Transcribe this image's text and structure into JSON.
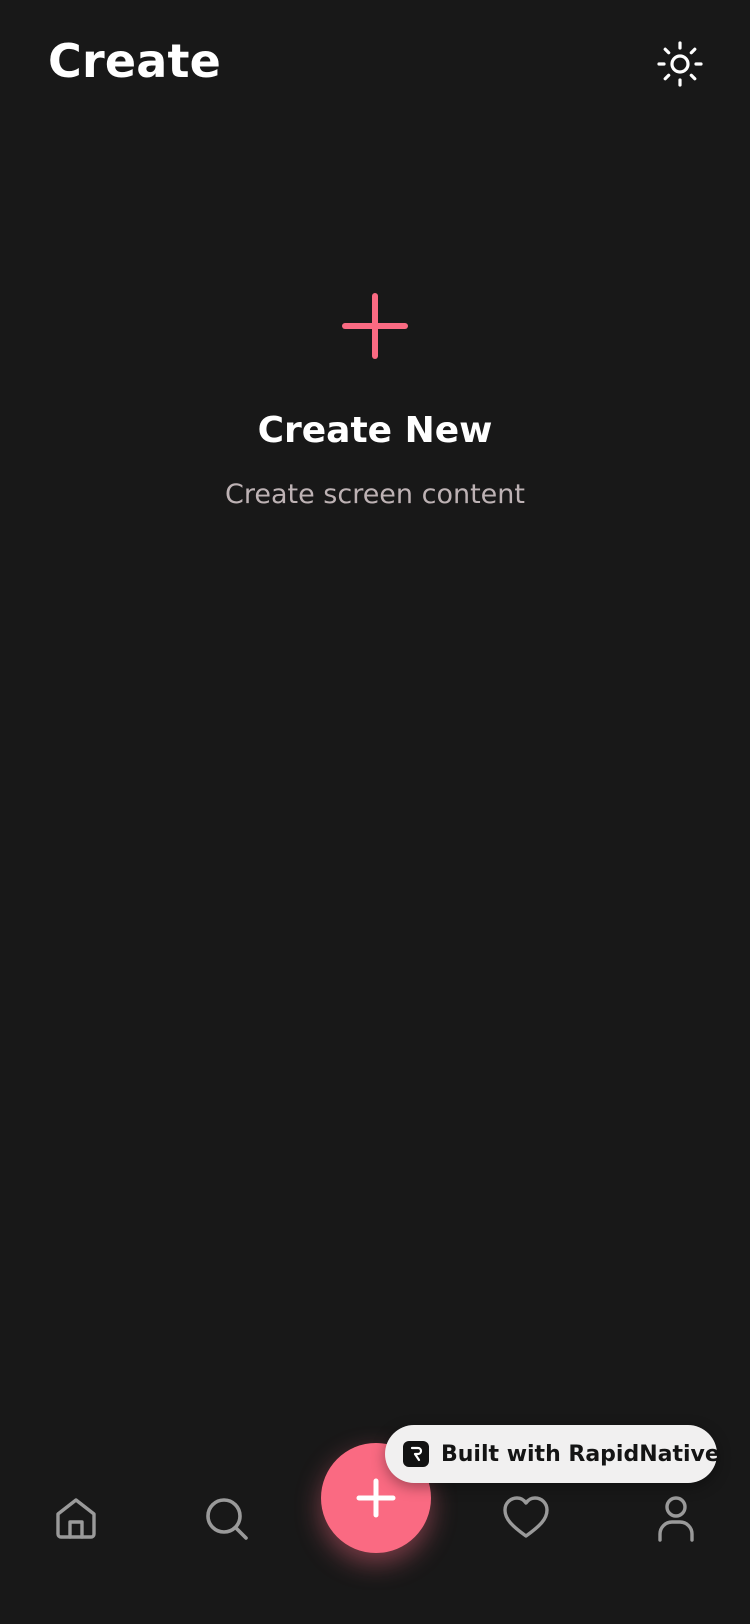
{
  "header": {
    "title": "Create"
  },
  "empty_state": {
    "title": "Create New",
    "subtitle": "Create screen content"
  },
  "badge": {
    "label": "Built with RapidNative"
  },
  "icons": {
    "theme_toggle": "sun-icon",
    "empty_state": "plus-icon",
    "nav_home": "home-icon",
    "nav_search": "search-icon",
    "nav_create": "plus-icon",
    "nav_favorites": "heart-icon",
    "nav_profile": "user-icon",
    "badge_logo": "rapidnative-logo"
  },
  "colors": {
    "background": "#181818",
    "accent": "#fa6a82",
    "text_primary": "#ffffff",
    "text_secondary": "#bdb2b4",
    "nav_icon": "#9a9a9a",
    "badge_bg": "#f1f0f0"
  }
}
